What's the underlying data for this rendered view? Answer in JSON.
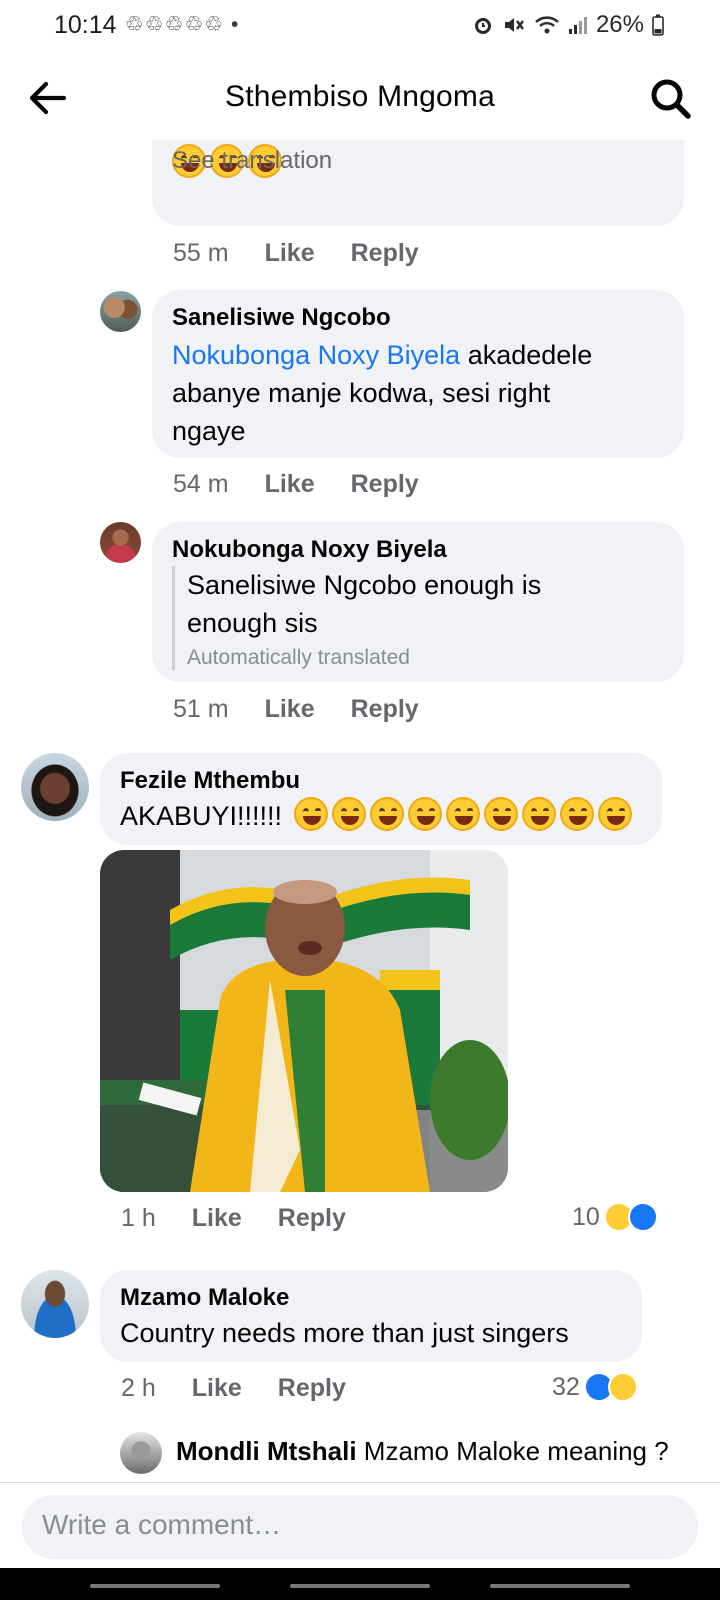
{
  "status": {
    "time": "10:14",
    "notifications": "♲♲♲♲♲ •",
    "battery": "26%"
  },
  "header": {
    "title": "Sthembiso Mngoma",
    "back_icon": "arrow-left-icon",
    "search_icon": "search-icon"
  },
  "comments": [
    {
      "partial_text_tail": "See translation",
      "time": "55 m",
      "like": "Like",
      "reply": "Reply"
    },
    {
      "author": "Sanelisiwe Ngcobo",
      "mention": "Nokubonga Noxy Biyela",
      "text_line1": "akadedele",
      "text_line2": "abanye manje kodwa, sesi right",
      "text_line3": "ngaye",
      "time": "54 m",
      "like": "Like",
      "reply": "Reply"
    },
    {
      "author": "Nokubonga Noxy Biyela",
      "text_line1": "Sanelisiwe Ngcobo enough is",
      "text_line2": "enough sis",
      "translated_note": "Automatically translated",
      "time": "51 m",
      "like": "Like",
      "reply": "Reply"
    },
    {
      "author": "Fezile Mthembu",
      "text": "AKABUYI!!!!!!",
      "time": "1 h",
      "like": "Like",
      "reply": "Reply",
      "reactions_count": "10"
    },
    {
      "author": "Mzamo Maloke",
      "text": "Country needs more than just singers",
      "time": "2 h",
      "like": "Like",
      "reply": "Reply",
      "reactions_count": "32"
    },
    {
      "author": "Mondli Mtshali",
      "text": "Mzamo Maloke meaning ?"
    }
  ],
  "composer": {
    "placeholder": "Write a comment…"
  },
  "colors": {
    "mention": "#1877f2",
    "bubble": "#f0f2f5",
    "muted": "#65676b",
    "like_reaction": "#1877f2",
    "haha_reaction": "#ffcc33",
    "jacket": "#f2b619",
    "flag_green": "#1a7a3a"
  }
}
